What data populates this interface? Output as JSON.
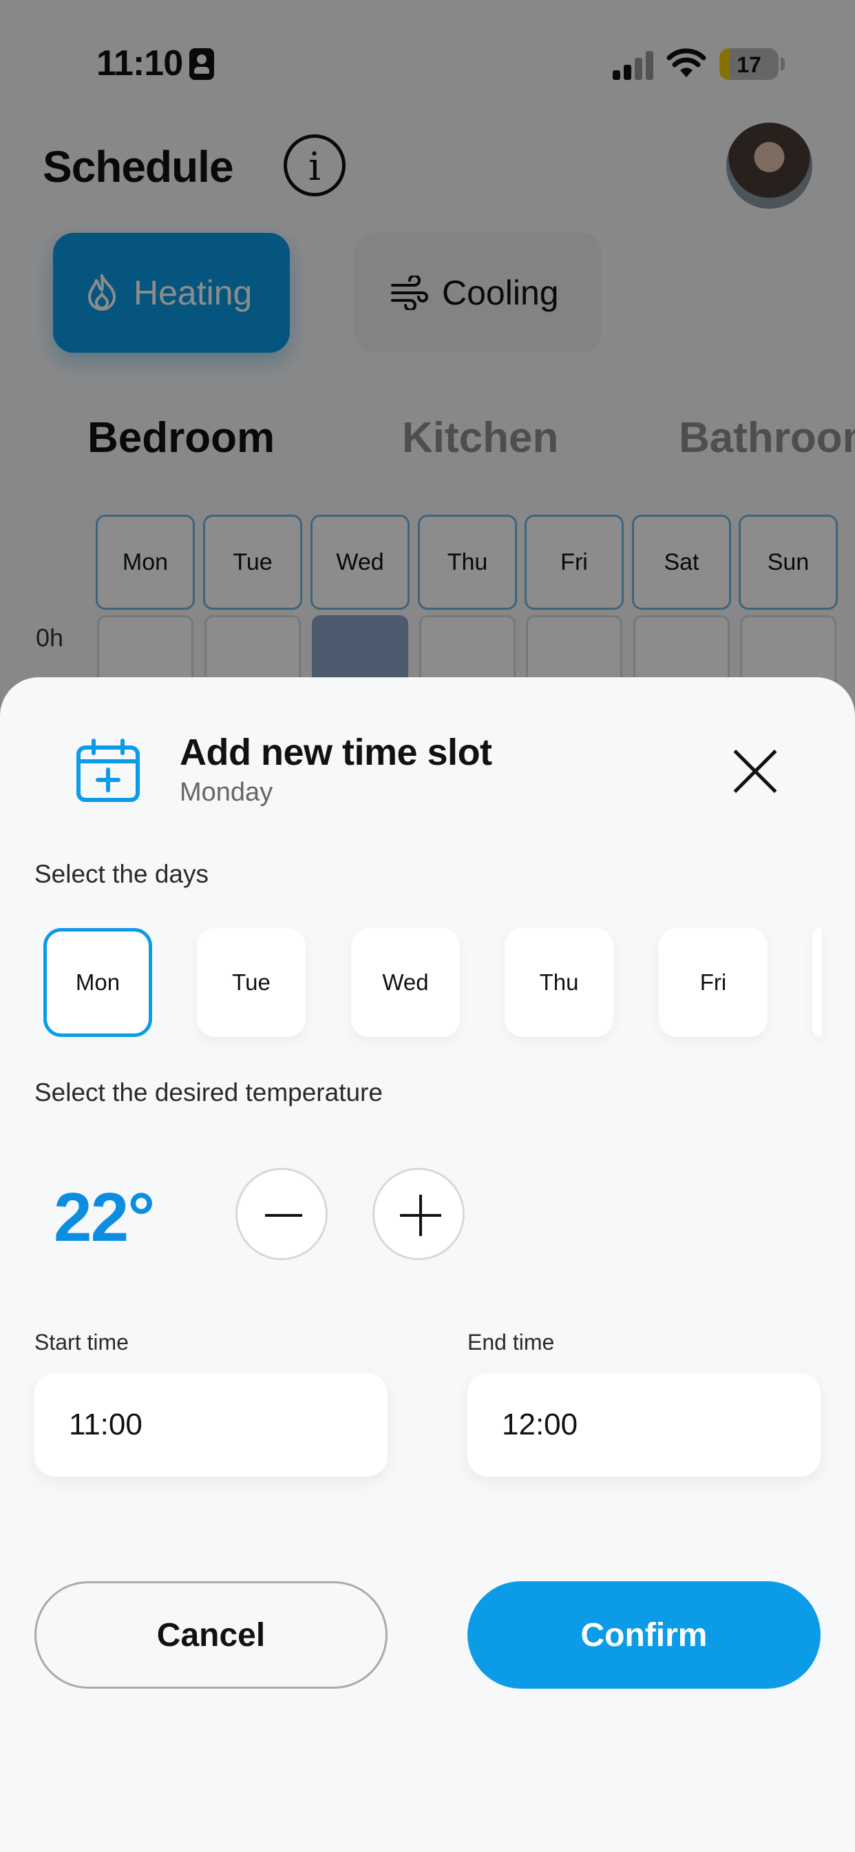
{
  "status_bar": {
    "time": "11:10",
    "battery": "17",
    "battery_level": 0.17
  },
  "header": {
    "title": "Schedule"
  },
  "modes": [
    {
      "label": "Heating",
      "active": true
    },
    {
      "label": "Cooling",
      "active": false
    }
  ],
  "rooms": [
    "Bedroom",
    "Kitchen",
    "Bathroom"
  ],
  "grid": {
    "days": [
      "Mon",
      "Tue",
      "Wed",
      "Thu",
      "Fri",
      "Sat",
      "Sun"
    ],
    "hour_label": "0h"
  },
  "sheet": {
    "title": "Add new time slot",
    "subtitle": "Monday",
    "days_label": "Select the days",
    "days": [
      "Mon",
      "Tue",
      "Wed",
      "Thu",
      "Fri"
    ],
    "selected_day": "Mon",
    "temp_label": "Select the desired temperature",
    "temperature": "22°",
    "start_label": "Start time",
    "start_value": "11:00",
    "end_label": "End time",
    "end_value": "12:00",
    "cancel": "Cancel",
    "confirm": "Confirm"
  },
  "colors": {
    "accent": "#0c9be6",
    "temperature": "#0c8ee0",
    "overlay": "rgba(0,0,0,0.45)"
  },
  "icons": [
    "info-icon",
    "flame-icon",
    "wind-icon",
    "calendar-plus-icon",
    "close-icon",
    "minus-icon",
    "plus-icon",
    "signal-icon",
    "wifi-icon",
    "battery-icon"
  ]
}
